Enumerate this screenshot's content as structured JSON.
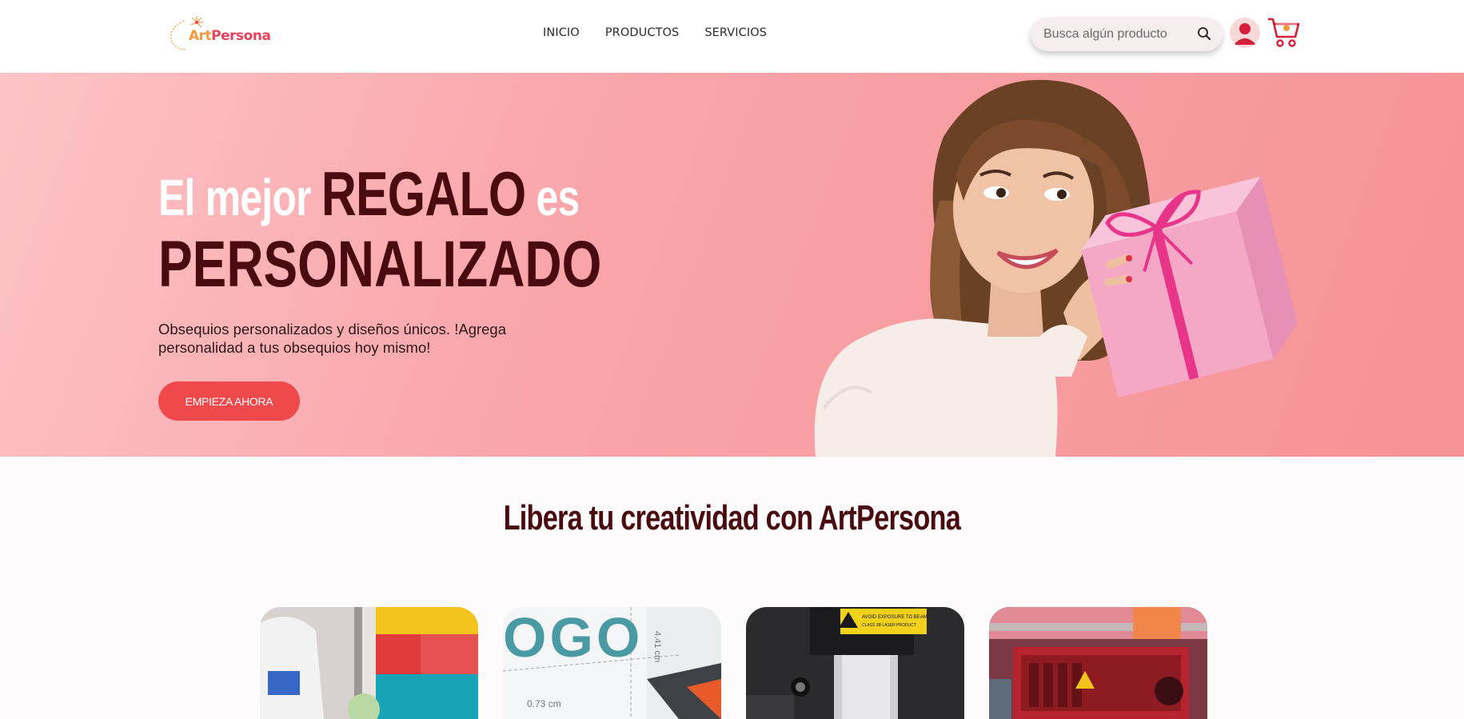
{
  "brand": {
    "name_part1": "Art",
    "name_part2": "Persona"
  },
  "nav": {
    "items": [
      {
        "label": "INICIO"
      },
      {
        "label": "PRODUCTOS"
      },
      {
        "label": "SERVICIOS"
      }
    ]
  },
  "search": {
    "placeholder": "Busca algún producto"
  },
  "hero": {
    "title_lead": "El mejor ",
    "title_emphasis": "REGALO",
    "title_tail": " es",
    "title_line2": "PERSONALIZADO",
    "description": "Obsequios personalizados y diseños únicos. !Agrega personalidad a tus obsequios hoy mismo!",
    "cta_label": "EMPIEZA AHORA"
  },
  "section": {
    "title": "Libera tu creatividad con ArtPersona"
  },
  "cards": [
    {
      "icon": "sublimation-photo"
    },
    {
      "icon": "logo-print-photo",
      "visible_text": "OGO"
    },
    {
      "icon": "laser-machine-photo",
      "visible_text": "AVOID EXPOSURE TO BEAM CLASS 3B LASER PRODUCT"
    },
    {
      "icon": "3d-printer-photo"
    }
  ],
  "colors": {
    "accent": "#f0494c",
    "dark_title": "#4a0b10",
    "hero_bg": "#f9a5aa",
    "brand_red": "#e8435a",
    "brand_orange": "#f29a3c"
  }
}
